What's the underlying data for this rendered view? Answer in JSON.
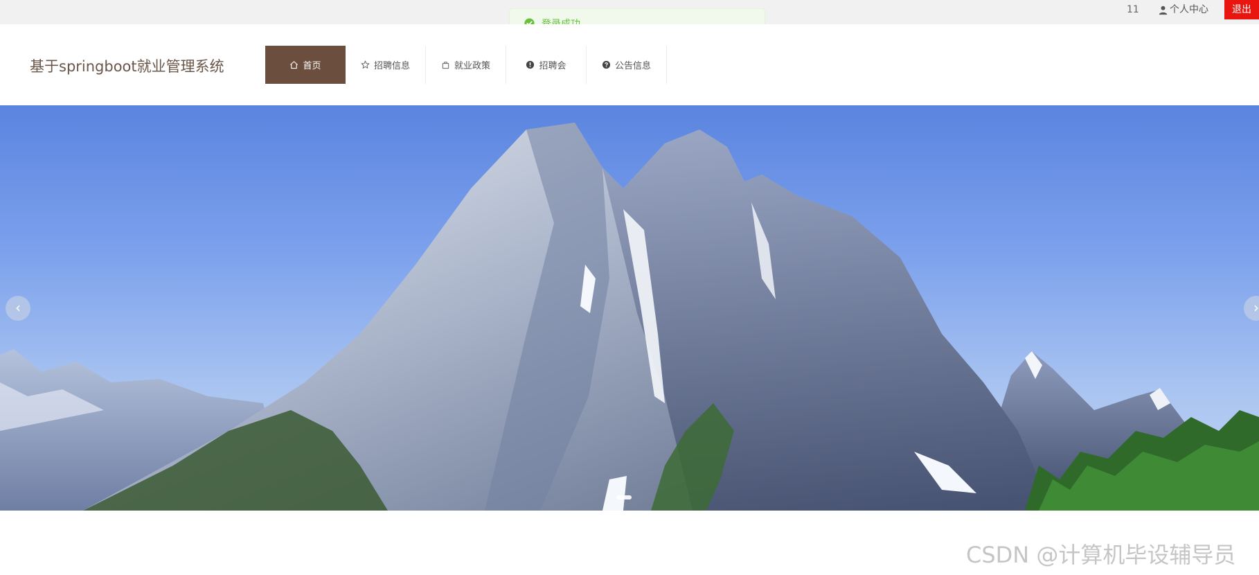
{
  "topbar": {
    "user_id": "11",
    "profile_label": "个人中心",
    "logout_label": "退出"
  },
  "toast": {
    "message": "登录成功"
  },
  "header": {
    "site_title": "基于springboot就业管理系统",
    "nav": [
      {
        "label": "首页",
        "icon": "home-icon"
      },
      {
        "label": "招聘信息",
        "icon": "star-icon"
      },
      {
        "label": "就业政策",
        "icon": "bag-icon"
      },
      {
        "label": "招聘会",
        "icon": "alert-circle-icon"
      },
      {
        "label": "公告信息",
        "icon": "help-circle-icon"
      }
    ]
  },
  "banner": {
    "prev_label": "‹",
    "next_label": "›"
  },
  "watermark": "CSDN @计算机毕设辅导员",
  "colors": {
    "nav_active": "#6b4e3d",
    "logout": "#e8160f",
    "toast_text": "#67c23a",
    "sky": "#5a84df"
  }
}
